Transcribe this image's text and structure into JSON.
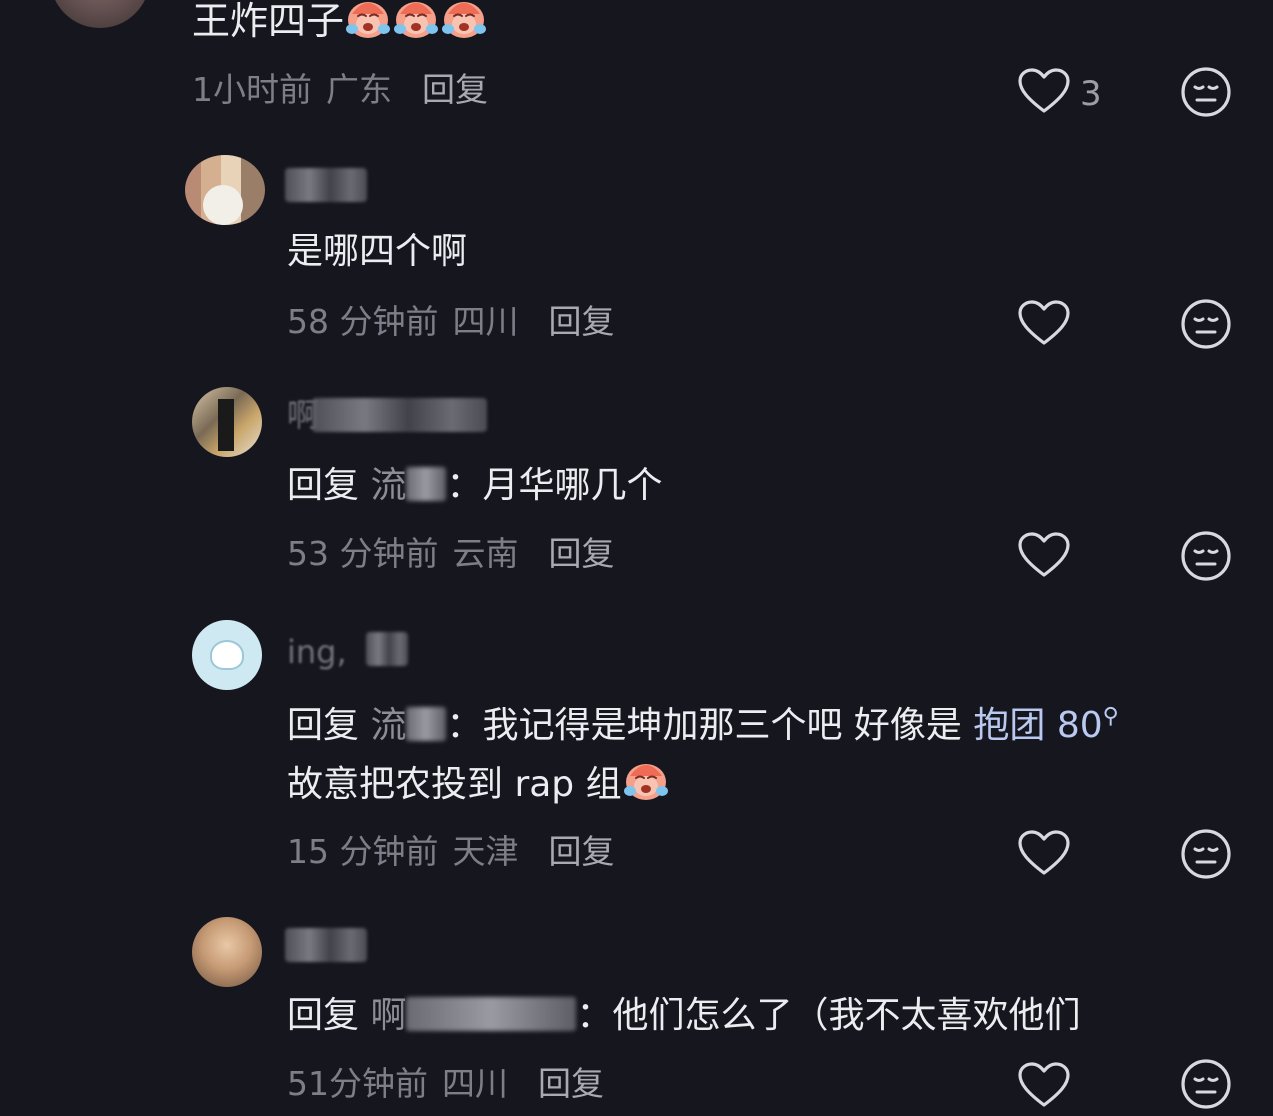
{
  "comments": [
    {
      "text": "王炸四子",
      "emoji_count": 3,
      "meta": {
        "time": "1小时前",
        "location": "广东",
        "reply": "回复"
      },
      "likes": "3"
    },
    {
      "name_hint": "",
      "text": "是哪四个啊",
      "meta": {
        "time": "58 分钟前",
        "location": "四川",
        "reply": "回复"
      }
    },
    {
      "name_hint": "啊",
      "reply_prefix": "回复",
      "reply_target": "流",
      "text": "：月华哪几个",
      "meta": {
        "time": "53 分钟前",
        "location": "云南",
        "reply": "回复"
      }
    },
    {
      "name_hint": "ing,",
      "reply_prefix": "回复",
      "reply_target": "流",
      "text_line1": "：我记得是坤加那三个吧 好像是",
      "hashtag": "抱团 80",
      "text_line2": "故意把农投到 rap 组",
      "meta": {
        "time": "15 分钟前",
        "location": "天津",
        "reply": "回复"
      }
    },
    {
      "name_hint": "",
      "reply_prefix": "回复",
      "reply_target": "啊",
      "text": "：他们怎么了（我不太喜欢他们",
      "meta": {
        "time": "51分钟前",
        "location": "四川",
        "reply": "回复"
      }
    }
  ],
  "icons": {
    "like": "heart-outline-icon",
    "dislike": "meh-face-icon",
    "emoji": "crying-face-emoji"
  },
  "colors": {
    "background": "#16161f",
    "text": "#ececf1",
    "meta": "#7e7e88",
    "hashtag": "#b9c9f0",
    "icon": "#d8d8de"
  }
}
